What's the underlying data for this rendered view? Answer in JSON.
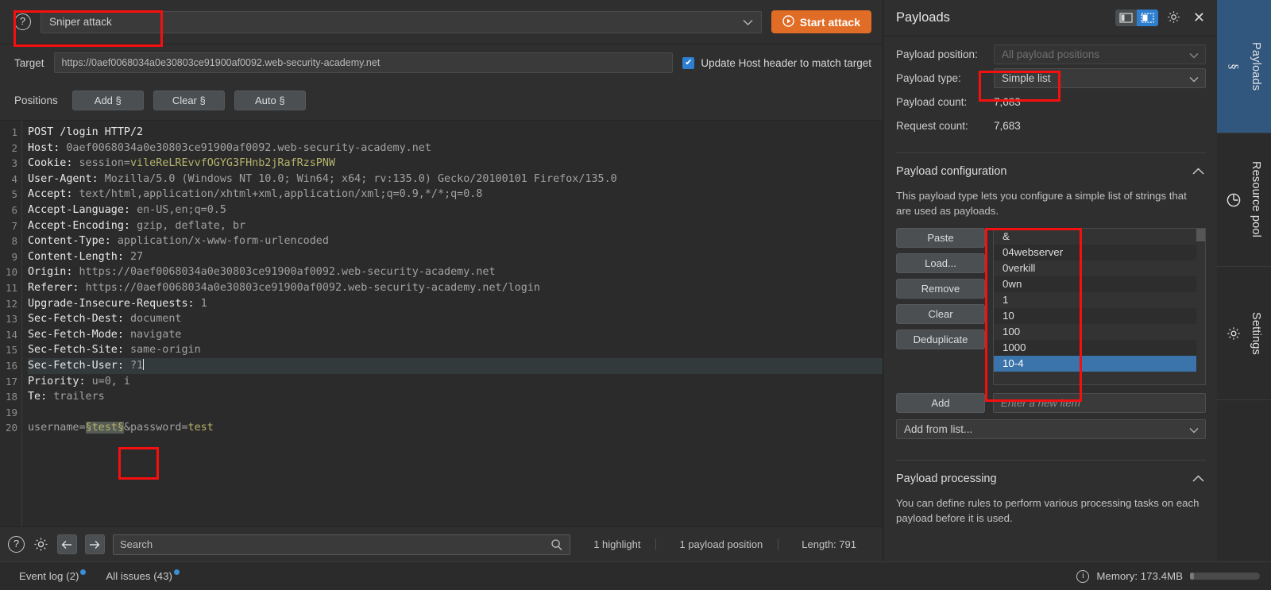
{
  "attack_bar": {
    "help_icon": "question-mark-icon",
    "attack_type": "Sniper attack",
    "start_button": "Start attack"
  },
  "target_bar": {
    "label": "Target",
    "url": "https://0aef0068034a0e30803ce91900af0092.web-security-academy.net",
    "update_host_label": "Update Host header to match target",
    "update_host_checked": true
  },
  "positions_bar": {
    "label": "Positions",
    "buttons": [
      "Add §",
      "Clear §",
      "Auto §"
    ]
  },
  "request": {
    "lines": [
      {
        "n": "1",
        "segs": [
          {
            "t": "POST /login HTTP/2",
            "c": "hdr-name"
          }
        ]
      },
      {
        "n": "2",
        "segs": [
          {
            "t": "Host: ",
            "c": "hdr-name"
          },
          {
            "t": "0aef0068034a0e30803ce91900af0092.web-security-academy.net",
            "c": "hdr-val"
          }
        ]
      },
      {
        "n": "3",
        "segs": [
          {
            "t": "Cookie: ",
            "c": "hdr-name"
          },
          {
            "t": "session=",
            "c": "hdr-val"
          },
          {
            "t": "vileReLREvvfOGYG3FHnb2jRafRzsPNW",
            "c": "val-olive"
          }
        ]
      },
      {
        "n": "4",
        "segs": [
          {
            "t": "User-Agent: ",
            "c": "hdr-name"
          },
          {
            "t": "Mozilla/5.0 (Windows NT 10.0; Win64; x64; rv:135.0) Gecko/20100101 Firefox/135.0",
            "c": "hdr-val"
          }
        ]
      },
      {
        "n": "5",
        "segs": [
          {
            "t": "Accept: ",
            "c": "hdr-name"
          },
          {
            "t": "text/html,application/xhtml+xml,application/xml;q=0.9,*/*;q=0.8",
            "c": "hdr-val"
          }
        ]
      },
      {
        "n": "6",
        "segs": [
          {
            "t": "Accept-Language: ",
            "c": "hdr-name"
          },
          {
            "t": "en-US,en;q=0.5",
            "c": "hdr-val"
          }
        ]
      },
      {
        "n": "7",
        "segs": [
          {
            "t": "Accept-Encoding: ",
            "c": "hdr-name"
          },
          {
            "t": "gzip, deflate, br",
            "c": "hdr-val"
          }
        ]
      },
      {
        "n": "8",
        "segs": [
          {
            "t": "Content-Type: ",
            "c": "hdr-name"
          },
          {
            "t": "application/x-www-form-urlencoded",
            "c": "hdr-val"
          }
        ]
      },
      {
        "n": "9",
        "segs": [
          {
            "t": "Content-Length: ",
            "c": "hdr-name"
          },
          {
            "t": "27",
            "c": "hdr-val"
          }
        ]
      },
      {
        "n": "10",
        "segs": [
          {
            "t": "Origin: ",
            "c": "hdr-name"
          },
          {
            "t": "https://0aef0068034a0e30803ce91900af0092.web-security-academy.net",
            "c": "hdr-val"
          }
        ]
      },
      {
        "n": "11",
        "segs": [
          {
            "t": "Referer: ",
            "c": "hdr-name"
          },
          {
            "t": "https://0aef0068034a0e30803ce91900af0092.web-security-academy.net/login",
            "c": "hdr-val"
          }
        ]
      },
      {
        "n": "12",
        "segs": [
          {
            "t": "Upgrade-Insecure-Requests: ",
            "c": "hdr-name"
          },
          {
            "t": "1",
            "c": "hdr-val"
          }
        ]
      },
      {
        "n": "13",
        "segs": [
          {
            "t": "Sec-Fetch-Dest: ",
            "c": "hdr-name"
          },
          {
            "t": "document",
            "c": "hdr-val"
          }
        ]
      },
      {
        "n": "14",
        "segs": [
          {
            "t": "Sec-Fetch-Mode: ",
            "c": "hdr-name"
          },
          {
            "t": "navigate",
            "c": "hdr-val"
          }
        ]
      },
      {
        "n": "15",
        "segs": [
          {
            "t": "Sec-Fetch-Site: ",
            "c": "hdr-name"
          },
          {
            "t": "same-origin",
            "c": "hdr-val"
          }
        ]
      },
      {
        "n": "16",
        "current": true,
        "segs": [
          {
            "t": "Sec-Fetch-User: ",
            "c": "hdr-name"
          },
          {
            "t": "?1",
            "c": "hdr-val"
          },
          {
            "t": "",
            "c": "caret"
          }
        ]
      },
      {
        "n": "17",
        "segs": [
          {
            "t": "Priority: ",
            "c": "hdr-name"
          },
          {
            "t": "u=0, i",
            "c": "hdr-val"
          }
        ]
      },
      {
        "n": "18",
        "segs": [
          {
            "t": "Te: ",
            "c": "hdr-name"
          },
          {
            "t": "trailers",
            "c": "hdr-val"
          }
        ]
      },
      {
        "n": "19",
        "segs": []
      },
      {
        "n": "20",
        "segs": [
          {
            "t": "username=",
            "c": "hdr-val"
          },
          {
            "t": "§test§",
            "c": "pmark"
          },
          {
            "t": "&password=",
            "c": "hdr-val"
          },
          {
            "t": "test",
            "c": "val-olive"
          }
        ]
      }
    ]
  },
  "search_bar": {
    "help_icon": "question-mark-icon",
    "settings_icon": "gear-icon",
    "back_icon": "arrow-left-icon",
    "forward_icon": "arrow-right-icon",
    "search_placeholder": "Search",
    "search_icon": "magnifier-icon",
    "stats": [
      "1 highlight",
      "1 payload position",
      "Length: 791"
    ]
  },
  "payloads_panel": {
    "title": "Payloads",
    "layout_icons": [
      "layout-left-icon",
      "layout-right-icon"
    ],
    "active_layout_index": 1,
    "settings_icon": "gear-icon",
    "close_icon": "close-icon",
    "fields": [
      {
        "key": "Payload position:",
        "value": "All payload positions",
        "type": "select",
        "disabled": true
      },
      {
        "key": "Payload type:",
        "value": "Simple list",
        "type": "select",
        "disabled": false
      },
      {
        "key": "Payload count:",
        "value": "7,683",
        "type": "text"
      },
      {
        "key": "Request count:",
        "value": "7,683",
        "type": "text"
      }
    ],
    "configuration": {
      "title": "Payload configuration",
      "collapse_icon": "chevron-up-icon",
      "description": "This payload type lets you configure a simple list of strings that are used as payloads.",
      "buttons": [
        "Paste",
        "Load...",
        "Remove",
        "Clear",
        "Deduplicate"
      ],
      "list_items": [
        "&",
        "04webserver",
        "0verkill",
        "0wn",
        "1",
        "10",
        "100",
        "1000",
        "10-4"
      ],
      "selected_index": 8,
      "add_button": "Add",
      "add_placeholder": "Enter a new item",
      "add_from_list": "Add from list..."
    },
    "processing": {
      "title": "Payload processing",
      "collapse_icon": "chevron-up-icon",
      "description": "You can define rules to perform various processing tasks on each payload before it is used."
    }
  },
  "vtabs": [
    {
      "label": "Payloads",
      "icon": "section-sign-icon",
      "active": true
    },
    {
      "label": "Resource pool",
      "icon": "clock-pie-icon",
      "active": false
    },
    {
      "label": "Settings",
      "icon": "gear-icon",
      "active": false
    }
  ],
  "status_bar": {
    "event_log": "Event log (2)",
    "all_issues": "All issues (43)",
    "info_icon": "info-icon",
    "memory": "Memory: 173.4MB"
  },
  "colors": {
    "accent_orange": "#e06c26",
    "accent_blue": "#2f7fd1",
    "annotation_red": "#f60f0f",
    "selected_row": "#3a74ab"
  }
}
